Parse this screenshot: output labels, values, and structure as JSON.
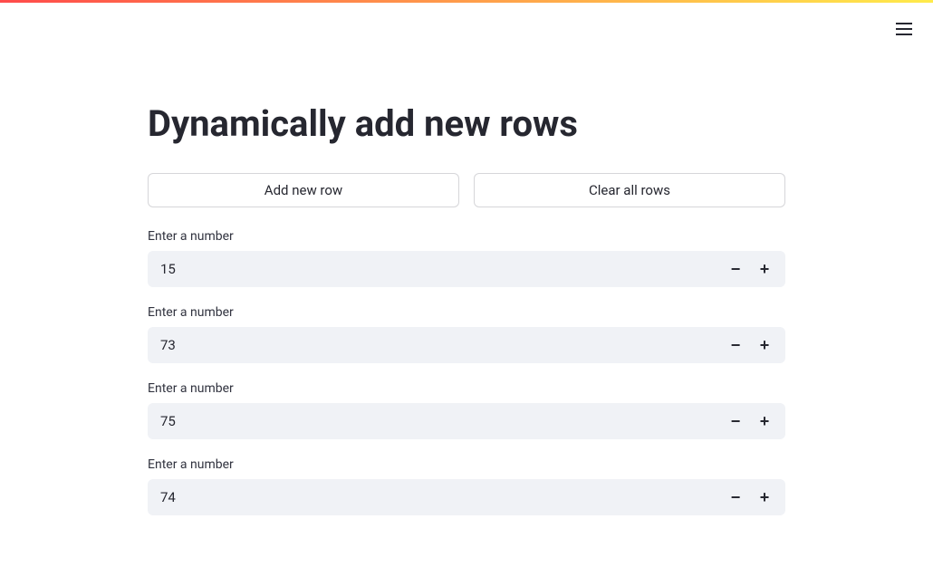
{
  "page": {
    "title": "Dynamically add new rows"
  },
  "buttons": {
    "add": "Add new row",
    "clear": "Clear all rows"
  },
  "rows": [
    {
      "label": "Enter a number",
      "value": "15"
    },
    {
      "label": "Enter a number",
      "value": "73"
    },
    {
      "label": "Enter a number",
      "value": "75"
    },
    {
      "label": "Enter a number",
      "value": "74"
    }
  ],
  "icons": {
    "minus": "−",
    "plus": "+"
  }
}
